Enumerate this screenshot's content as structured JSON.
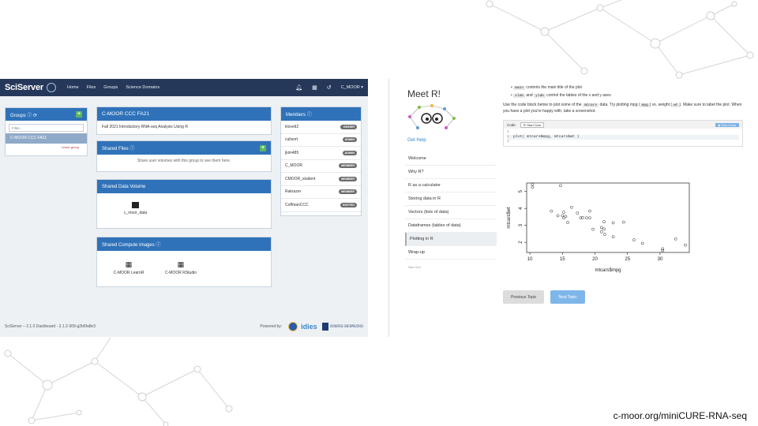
{
  "sciserver": {
    "logo": "SciServer",
    "nav": [
      "Home",
      "Files",
      "Groups",
      "Science Domains"
    ],
    "user": "C_MOOR ▾",
    "groups_title": "Groups",
    "filter_placeholder": "Filter...",
    "selected_group": "C-MOOR CCC FA21",
    "leave_group": "Leave group",
    "group_title": "C-MOOR CCC FA21",
    "group_desc": "Fall 2021 Introductory RNA-seq Analysis Using R",
    "shared_files_title": "Shared Files",
    "shared_files_msg": "Share user volumes with this group to see them here.",
    "shared_data_title": "Shared Data Volume",
    "shared_data_item": "c_moor_data",
    "shared_compute_title": "Shared Compute Images",
    "compute_images": [
      "C-MOOR LearnR",
      "C-MOOR RStudio"
    ],
    "members_title": "Members",
    "members": [
      {
        "name": "klovett2",
        "role": "OWNER"
      },
      {
        "name": "cultsort",
        "role": "ADMIN"
      },
      {
        "name": "jkim485",
        "role": "ADMIN"
      },
      {
        "name": "C_MOOR",
        "role": "MEMBER"
      },
      {
        "name": "CMOOR_student",
        "role": "MEMBER"
      },
      {
        "name": "Rakrazer",
        "role": "MEMBER"
      },
      {
        "name": "CoffmanCCC",
        "role": "INVITED"
      }
    ],
    "footer_version": "SciServer – 2.1.0",
    "footer_dash": "Dashboard - 2.1.2-309-g2b6fa8e3",
    "powered_by": "Powered by:",
    "idies": "idies",
    "jhu": "JOHNS HOPKINS"
  },
  "meet_r": {
    "title": "Meet R!",
    "help": "Get Help",
    "toc": [
      "Welcome",
      "Why R?",
      "R as a calculator",
      "Storing data in R",
      "Vectors (lists of data)",
      "Dataframes (tables of data)",
      "Plotting in R",
      "Wrap-up"
    ],
    "toc_active_index": 6,
    "toc_footer": "Start Over",
    "bullet1_code": "main",
    "bullet1_text": " controls the main title of the plot",
    "bullet2_code1": "xlab",
    "bullet2_mid": " and ",
    "bullet2_code2": "ylab",
    "bullet2_text": " control the tables of the x and y axes",
    "instr_a": "Use the code block below to plot some of the ",
    "instr_code": "mtcars",
    "instr_b": " data. Try plotting mpg (",
    "instr_code2": "mpg",
    "instr_c": ") vs. weight (",
    "instr_code3": "wt",
    "instr_d": "). Make sure to label the plot. When you have a plot you're happy with, take a screenshot.",
    "code_label": "Code",
    "start_over": "Start Over",
    "run_code": "▶ Run Code",
    "code_lines": [
      "",
      "plot( mtcars$mpg, mtcars$wt )",
      ""
    ],
    "prev_btn": "Previous Topic",
    "next_btn": "Next Topic"
  },
  "chart_data": {
    "type": "scatter",
    "xlabel": "mtcars$mpg",
    "ylabel": "mtcars$wt",
    "xticks": [
      10,
      15,
      20,
      25,
      30
    ],
    "yticks": [
      2,
      3,
      4,
      5
    ],
    "xlim": [
      9.5,
      34.5
    ],
    "ylim": [
      1.4,
      5.5
    ],
    "points": [
      [
        21.0,
        2.62
      ],
      [
        21.0,
        2.875
      ],
      [
        22.8,
        2.32
      ],
      [
        21.4,
        3.215
      ],
      [
        18.7,
        3.44
      ],
      [
        18.1,
        3.46
      ],
      [
        14.3,
        3.57
      ],
      [
        24.4,
        3.19
      ],
      [
        22.8,
        3.15
      ],
      [
        19.2,
        3.44
      ],
      [
        17.8,
        3.44
      ],
      [
        16.4,
        4.07
      ],
      [
        17.3,
        3.73
      ],
      [
        15.2,
        3.78
      ],
      [
        10.4,
        5.25
      ],
      [
        10.4,
        5.424
      ],
      [
        14.7,
        5.345
      ],
      [
        32.4,
        2.2
      ],
      [
        30.4,
        1.615
      ],
      [
        33.9,
        1.835
      ],
      [
        21.5,
        2.465
      ],
      [
        15.5,
        3.52
      ],
      [
        15.2,
        3.435
      ],
      [
        13.3,
        3.84
      ],
      [
        19.2,
        3.845
      ],
      [
        27.3,
        1.935
      ],
      [
        26.0,
        2.14
      ],
      [
        30.4,
        1.513
      ],
      [
        15.8,
        3.17
      ],
      [
        19.7,
        2.77
      ],
      [
        15.0,
        3.57
      ],
      [
        21.4,
        2.78
      ]
    ]
  },
  "url": "c-moor.org/miniCURE-RNA-seq"
}
